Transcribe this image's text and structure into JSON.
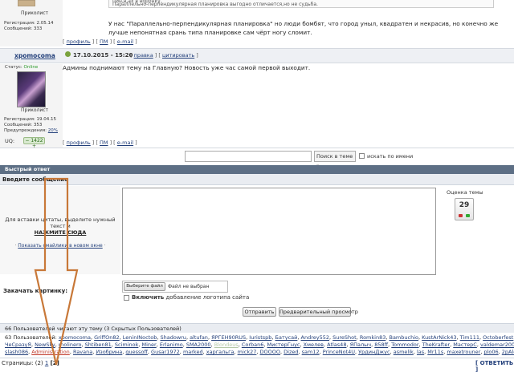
{
  "post1": {
    "rank": "Приколист",
    "stats": [
      "Регистрация: 2.05.14",
      "Сообщений: 333"
    ],
    "quote_lines": [
      "цин,в,ах в воронку.",
      "Параллельно-перпендикулярная планировка выгодно отличается,но не судьба."
    ],
    "text": "У нас \"Параллельно-перпендикулярная планировка\" но люди бомбят, что город уныл, квадратен и некрасив, но конечно же лучше непонятная срань типа планировке сам чёрт ногу сломит.",
    "links": {
      "profile": "профиль",
      "pm": "ПМ",
      "email": "e-mail"
    }
  },
  "post2": {
    "author": "xpomocoma",
    "date": "17.10.2015 - 15:20",
    "actions": {
      "edit": "правка",
      "quote": "цитировать"
    },
    "status_label": "Статус:",
    "status_value": "Online",
    "rank": "Приколист",
    "stats": [
      "Регистрация: 19.04.15",
      "Сообщений: 353",
      "Предупреждения:"
    ],
    "warn": "20%",
    "uq_label": "UQ:",
    "reputation": "1422",
    "text": "Админы поднимают тему на Главную? Новость уже час самой первой выходит.",
    "links": {
      "profile": "профиль",
      "pm": "ПМ",
      "email": "e-mail"
    }
  },
  "search": {
    "scope": "Поиск в теме",
    "by_name": "искать по имени"
  },
  "quick_reply": {
    "title": "Быстрый ответ",
    "subtitle": "Введите сообщение",
    "hint": "Для вставки цитаты, выделите нужный текст и",
    "click_here": "НАЖМИТЕ СЮДА",
    "smilies": "Показать смайлики в новом окне",
    "rating_label": "Оценка темы",
    "rating_value": "29",
    "attach_label": "Закачать картинку:",
    "file_button": "Выберите файл",
    "file_status": "Файл не выбран",
    "logo_bold": "Включить",
    "logo_rest": "добавление логотипа сайта",
    "send": "Отправить",
    "preview": "Предварительный просмотр"
  },
  "online": {
    "header": "66 Пользователей читают эту тему (3 Скрытых Пользователей)",
    "prefix": "63 Пользователей:",
    "row1": [
      "xpomocoma",
      "GriffOn82",
      "LeninINoctob",
      "Shadowru",
      "altufan",
      "ЯРГЕН90RUS",
      "Iuristspb",
      "Батусай",
      "Andrey552",
      "SureShot",
      "Romkin83",
      "Bambuchio",
      "KustArNick43",
      "Tim111",
      "Octoberfest",
      "raidar"
    ],
    "row2": [
      "ЧеСразуЯ",
      "NewSky",
      "molinero",
      "Shtiben81",
      "Sciminok",
      "Miner",
      "Erlanimo",
      "SMA2000",
      "Blondeus",
      "Corban6",
      "МистерГнус",
      "Хмелев",
      "Atlas48",
      "ЯПалыч",
      "858ff",
      "Tommodor",
      "TheKrafter",
      "МастерС",
      "valdemar2005",
      "Motor"
    ],
    "row3_admin": "Administration",
    "row3_pre": "slash086",
    "row3": [
      "Ravana",
      "Изобрина",
      "guessoff",
      "Gusar1972",
      "marked",
      "харгальга",
      "mick27",
      "DOOOO",
      "Dized",
      "sam12",
      "PrinceNot4U",
      "УрдинДжус",
      "asmelik",
      "las",
      "Mr11s",
      "maxetrouner",
      "plo06",
      "2pAlex",
      "otr"
    ]
  },
  "pager": {
    "label": "Страницы:",
    "count": "(2)",
    "page1": "1",
    "page2": "[2]",
    "reply": "[ ОТВЕТИТЬ ]"
  }
}
